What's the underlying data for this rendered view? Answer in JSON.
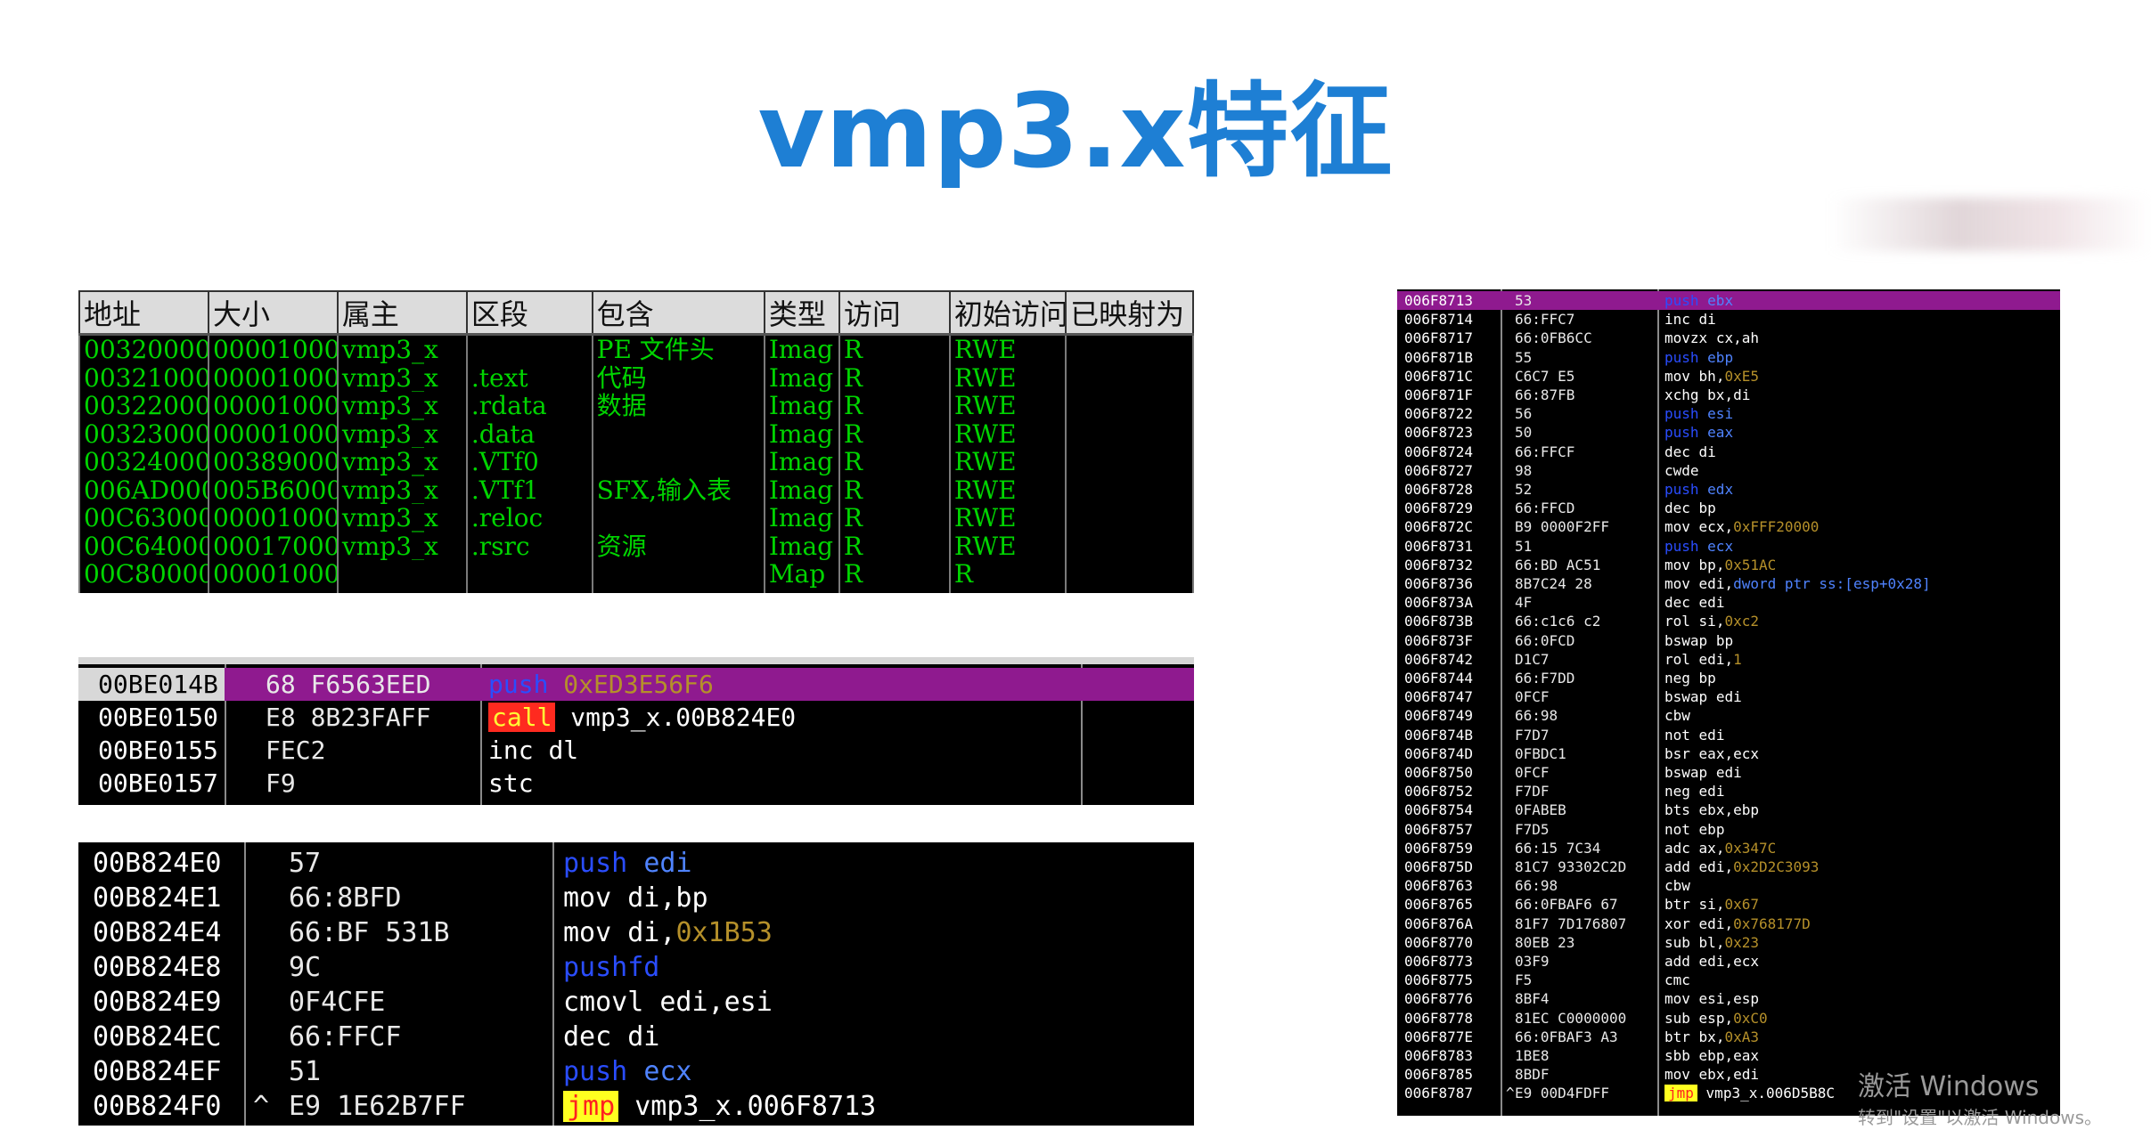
{
  "title": "vmp3.x特征",
  "memory_map": {
    "headers": [
      "地址",
      "大小",
      "属主",
      "区段",
      "包含",
      "类型",
      "访问",
      "初始访问",
      "已映射为"
    ],
    "rows": [
      [
        "00320000",
        "00001000",
        "vmp3_x",
        "",
        "PE 文件头",
        "Imag",
        "R",
        "RWE",
        ""
      ],
      [
        "00321000",
        "00001000",
        "vmp3_x",
        ".text",
        "代码",
        "Imag",
        "R",
        "RWE",
        ""
      ],
      [
        "00322000",
        "00001000",
        "vmp3_x",
        ".rdata",
        "数据",
        "Imag",
        "R",
        "RWE",
        ""
      ],
      [
        "00323000",
        "00001000",
        "vmp3_x",
        ".data",
        "",
        "Imag",
        "R",
        "RWE",
        ""
      ],
      [
        "00324000",
        "00389000",
        "vmp3_x",
        ".VTf0",
        "",
        "Imag",
        "R",
        "RWE",
        ""
      ],
      [
        "006AD000",
        "005B6000",
        "vmp3_x",
        ".VTf1",
        "SFX,输入表",
        "Imag",
        "R",
        "RWE",
        ""
      ],
      [
        "00C63000",
        "00001000",
        "vmp3_x",
        ".reloc",
        "",
        "Imag",
        "R",
        "RWE",
        ""
      ],
      [
        "00C64000",
        "00017000",
        "vmp3_x",
        ".rsrc",
        "资源",
        "Imag",
        "R",
        "RWE",
        ""
      ],
      [
        "00C80000",
        "00001000",
        "",
        "",
        "",
        "Map",
        "R",
        "R",
        ""
      ]
    ]
  },
  "disasm_entry": [
    {
      "addr": "00BE014B",
      "bytes": "68 F6563EED",
      "mn": "push",
      "op": "0xED3E56F6",
      "mn_style": "blue",
      "op_style": "hex",
      "selected": true
    },
    {
      "addr": "00BE0150",
      "bytes": "E8 8B23FAFF",
      "mn": "call",
      "op": "vmp3_x.00B824E0",
      "mn_style": "call",
      "op_style": "white",
      "selected": false
    },
    {
      "addr": "00BE0155",
      "bytes": "FEC2",
      "mn": "inc",
      "op": "dl",
      "mn_style": "white",
      "op_style": "white",
      "selected": false
    },
    {
      "addr": "00BE0157",
      "bytes": "F9",
      "mn": "stc",
      "op": "",
      "mn_style": "white",
      "op_style": "white",
      "selected": false
    }
  ],
  "disasm_handler": [
    {
      "addr": "00B824E0",
      "bytes": "57",
      "mn": "push",
      "op": "edi",
      "mn_style": "blue",
      "op_style": "blue",
      "mark": ""
    },
    {
      "addr": "00B824E1",
      "bytes": "66:8BFD",
      "mn": "mov",
      "op": "di,bp",
      "mn_style": "white",
      "op_style": "white",
      "mark": ""
    },
    {
      "addr": "00B824E4",
      "bytes": "66:BF 531B",
      "mn": "mov",
      "op": "di,",
      "op2": "0x1B53",
      "mn_style": "white",
      "op_style": "white",
      "mark": ""
    },
    {
      "addr": "00B824E8",
      "bytes": "9C",
      "mn": "pushfd",
      "op": "",
      "mn_style": "blue",
      "op_style": "white",
      "mark": ""
    },
    {
      "addr": "00B824E9",
      "bytes": "0F4CFE",
      "mn": "cmovl",
      "op": "edi,esi",
      "mn_style": "white",
      "op_style": "white",
      "mark": ""
    },
    {
      "addr": "00B824EC",
      "bytes": "66:FFCF",
      "mn": "dec",
      "op": "di",
      "mn_style": "white",
      "op_style": "white",
      "mark": ""
    },
    {
      "addr": "00B824EF",
      "bytes": "51",
      "mn": "push",
      "op": "ecx",
      "mn_style": "blue",
      "op_style": "blue",
      "mark": ""
    },
    {
      "addr": "00B824F0",
      "bytes": "E9 1E62B7FF",
      "mn": "jmp",
      "op": "vmp3_x.006F8713",
      "mn_style": "jmp",
      "op_style": "white",
      "mark": "^"
    }
  ],
  "disasm_long": [
    {
      "addr": "006F8713",
      "bytes": "53",
      "mn": "push",
      "op": "ebx",
      "mn_style": "blue",
      "op_style": "blue",
      "selected": true
    },
    {
      "addr": "006F8714",
      "bytes": "66:FFC7",
      "mn": "inc",
      "op": "di",
      "mn_style": "white",
      "op_style": "white"
    },
    {
      "addr": "006F8717",
      "bytes": "66:0FB6CC",
      "mn": "movzx",
      "op": "cx,ah",
      "mn_style": "white",
      "op_style": "white"
    },
    {
      "addr": "006F871B",
      "bytes": "55",
      "mn": "push",
      "op": "ebp",
      "mn_style": "blue",
      "op_style": "blue"
    },
    {
      "addr": "006F871C",
      "bytes": "C6C7 E5",
      "mn": "mov",
      "op": "bh,",
      "op2": "0xE5",
      "mn_style": "white",
      "op_style": "white"
    },
    {
      "addr": "006F871F",
      "bytes": "66:87FB",
      "mn": "xchg",
      "op": "bx,di",
      "mn_style": "white",
      "op_style": "white"
    },
    {
      "addr": "006F8722",
      "bytes": "56",
      "mn": "push",
      "op": "esi",
      "mn_style": "blue",
      "op_style": "blue"
    },
    {
      "addr": "006F8723",
      "bytes": "50",
      "mn": "push",
      "op": "eax",
      "mn_style": "blue",
      "op_style": "blue"
    },
    {
      "addr": "006F8724",
      "bytes": "66:FFCF",
      "mn": "dec",
      "op": "di",
      "mn_style": "white",
      "op_style": "white"
    },
    {
      "addr": "006F8727",
      "bytes": "98",
      "mn": "cwde",
      "op": "",
      "mn_style": "white",
      "op_style": "white"
    },
    {
      "addr": "006F8728",
      "bytes": "52",
      "mn": "push",
      "op": "edx",
      "mn_style": "blue",
      "op_style": "blue"
    },
    {
      "addr": "006F8729",
      "bytes": "66:FFCD",
      "mn": "dec",
      "op": "bp",
      "mn_style": "white",
      "op_style": "white"
    },
    {
      "addr": "006F872C",
      "bytes": "B9 0000F2FF",
      "mn": "mov",
      "op": "ecx,",
      "op2": "0xFFF20000",
      "mn_style": "white",
      "op_style": "white"
    },
    {
      "addr": "006F8731",
      "bytes": "51",
      "mn": "push",
      "op": "ecx",
      "mn_style": "blue",
      "op_style": "blue"
    },
    {
      "addr": "006F8732",
      "bytes": "66:BD AC51",
      "mn": "mov",
      "op": "bp,",
      "op2": "0x51AC",
      "mn_style": "white",
      "op_style": "white"
    },
    {
      "addr": "006F8736",
      "bytes": "8B7C24 28",
      "mn": "mov",
      "op": "edi,",
      "op3": "dword ptr ss:[esp+0x28]",
      "mn_style": "white",
      "op_style": "white"
    },
    {
      "addr": "006F873A",
      "bytes": "4F",
      "mn": "dec",
      "op": "edi",
      "mn_style": "white",
      "op_style": "white"
    },
    {
      "addr": "006F873B",
      "bytes": "66:c1c6 c2",
      "mn": "rol",
      "op": "si,",
      "op2": "0xc2",
      "mn_style": "white",
      "op_style": "white"
    },
    {
      "addr": "006F873F",
      "bytes": "66:0FCD",
      "mn": "bswap",
      "op": "bp",
      "mn_style": "white",
      "op_style": "white"
    },
    {
      "addr": "006F8742",
      "bytes": "D1C7",
      "mn": "rol",
      "op": "edi,",
      "op2": "1",
      "mn_style": "white",
      "op_style": "white"
    },
    {
      "addr": "006F8744",
      "bytes": "66:F7DD",
      "mn": "neg",
      "op": "bp",
      "mn_style": "white",
      "op_style": "white"
    },
    {
      "addr": "006F8747",
      "bytes": "0FCF",
      "mn": "bswap",
      "op": "edi",
      "mn_style": "white",
      "op_style": "white"
    },
    {
      "addr": "006F8749",
      "bytes": "66:98",
      "mn": "cbw",
      "op": "",
      "mn_style": "white",
      "op_style": "white"
    },
    {
      "addr": "006F874B",
      "bytes": "F7D7",
      "mn": "not",
      "op": "edi",
      "mn_style": "white",
      "op_style": "white"
    },
    {
      "addr": "006F874D",
      "bytes": "0FBDC1",
      "mn": "bsr",
      "op": "eax,ecx",
      "mn_style": "white",
      "op_style": "white"
    },
    {
      "addr": "006F8750",
      "bytes": "0FCF",
      "mn": "bswap",
      "op": "edi",
      "mn_style": "white",
      "op_style": "white"
    },
    {
      "addr": "006F8752",
      "bytes": "F7DF",
      "mn": "neg",
      "op": "edi",
      "mn_style": "white",
      "op_style": "white"
    },
    {
      "addr": "006F8754",
      "bytes": "0FABEB",
      "mn": "bts",
      "op": "ebx,ebp",
      "mn_style": "white",
      "op_style": "white"
    },
    {
      "addr": "006F8757",
      "bytes": "F7D5",
      "mn": "not",
      "op": "ebp",
      "mn_style": "white",
      "op_style": "white"
    },
    {
      "addr": "006F8759",
      "bytes": "66:15 7C34",
      "mn": "adc",
      "op": "ax,",
      "op2": "0x347C",
      "mn_style": "white",
      "op_style": "white"
    },
    {
      "addr": "006F875D",
      "bytes": "81C7 93302C2D",
      "mn": "add",
      "op": "edi,",
      "op2": "0x2D2C3093",
      "mn_style": "white",
      "op_style": "white"
    },
    {
      "addr": "006F8763",
      "bytes": "66:98",
      "mn": "cbw",
      "op": "",
      "mn_style": "white",
      "op_style": "white"
    },
    {
      "addr": "006F8765",
      "bytes": "66:0FBAF6 67",
      "mn": "btr",
      "op": "si,",
      "op2": "0x67",
      "mn_style": "white",
      "op_style": "white"
    },
    {
      "addr": "006F876A",
      "bytes": "81F7 7D176807",
      "mn": "xor",
      "op": "edi,",
      "op2": "0x768177D",
      "mn_style": "white",
      "op_style": "white"
    },
    {
      "addr": "006F8770",
      "bytes": "80EB 23",
      "mn": "sub",
      "op": "bl,",
      "op2": "0x23",
      "mn_style": "white",
      "op_style": "white"
    },
    {
      "addr": "006F8773",
      "bytes": "03F9",
      "mn": "add",
      "op": "edi,ecx",
      "mn_style": "white",
      "op_style": "white"
    },
    {
      "addr": "006F8775",
      "bytes": "F5",
      "mn": "cmc",
      "op": "",
      "mn_style": "white",
      "op_style": "white"
    },
    {
      "addr": "006F8776",
      "bytes": "8BF4",
      "mn": "mov",
      "op": "esi,esp",
      "mn_style": "white",
      "op_style": "white"
    },
    {
      "addr": "006F8778",
      "bytes": "81EC C0000000",
      "mn": "sub",
      "op": "esp,",
      "op2": "0xC0",
      "mn_style": "white",
      "op_style": "white"
    },
    {
      "addr": "006F877E",
      "bytes": "66:0FBAF3 A3",
      "mn": "btr",
      "op": "bx,",
      "op2": "0xA3",
      "mn_style": "white",
      "op_style": "white"
    },
    {
      "addr": "006F8783",
      "bytes": "1BE8",
      "mn": "sbb",
      "op": "ebp,eax",
      "mn_style": "white",
      "op_style": "white"
    },
    {
      "addr": "006F8785",
      "bytes": "8BDF",
      "mn": "mov",
      "op": "ebx,edi",
      "mn_style": "white",
      "op_style": "white"
    },
    {
      "addr": "006F8787",
      "bytes": "E9 00D4FDFF",
      "mn": "jmp",
      "op": "vmp3_x.006D5B8C",
      "mn_style": "jmp",
      "op_style": "white",
      "mark": "^"
    }
  ],
  "watermark": {
    "line1": "激活 Windows",
    "line2": "转到\"设置\"以激活 Windows。"
  }
}
